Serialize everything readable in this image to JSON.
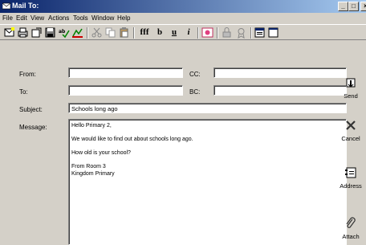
{
  "window": {
    "title": "Mail To:"
  },
  "menu": [
    "File",
    "Edit",
    "View",
    "Actions",
    "Tools",
    "Window",
    "Help"
  ],
  "toolbar": {
    "font_label": "fff",
    "bold_label": "b",
    "underline_label": "u",
    "italic_label": "i"
  },
  "form": {
    "from_label": "From:",
    "to_label": "To:",
    "cc_label": "CC:",
    "bc_label": "BC:",
    "subject_label": "Subject:",
    "message_label": "Message:",
    "from_value": "",
    "to_value": "",
    "cc_value": "",
    "bc_value": "",
    "subject_value": "Schools long ago"
  },
  "message": {
    "greeting": "Hello Primary 2,",
    "line1": "We would like to find out about schools long ago.",
    "line2": "How old is your school?",
    "sign1": "From Room 3",
    "sign2": "Kingdom Primary"
  },
  "side": {
    "send_label": "Send",
    "cancel_label": "Cancel",
    "address_label": "Address",
    "attach_label": "Attach"
  },
  "colors": {
    "titlebar_start": "#0a246a",
    "titlebar_end": "#a6caf0",
    "face": "#d4d0c8"
  },
  "icons": [
    "mail-icon",
    "minimize-icon",
    "maximize-icon",
    "close-icon",
    "send-icon",
    "cancel-x-icon",
    "address-book-icon",
    "paperclip-icon"
  ]
}
